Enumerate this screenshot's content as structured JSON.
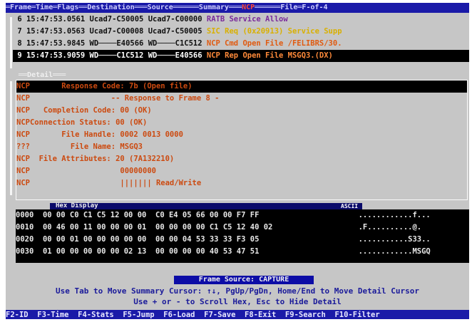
{
  "title_bar": {
    "left": "═Frame═Time═Flags══Destination═══Source══════Summary═══",
    "protocol": "NCP",
    "right": "══════File═F-of-4"
  },
  "summary_rows": [
    {
      "frame": " 6",
      "time": "15:47:53.0561",
      "dest": "Ucad7-C50005",
      "src": "Ucad7-C00000",
      "summary": "RATB Service Allow",
      "color": "purple"
    },
    {
      "frame": " 7",
      "time": "15:47:53.0563",
      "dest": "Ucad7-C00008",
      "src": "Ucad7-C50005",
      "summary": "SIC Req (0x20913) Service Supp",
      "color": "yellow"
    },
    {
      "frame": " 8",
      "time": "15:47:53.9845",
      "dest": "WD────E40566",
      "src": "WD────C1C512",
      "summary": "NCP Cmd Open File /FELIBRS/30.",
      "color": "orange"
    },
    {
      "frame": " 9",
      "time": "15:47:53.9059",
      "dest": "WD────C1C512",
      "src": "WD────E40566",
      "summary": "NCP Rep Open File MSGQ3.(DX)",
      "color": "ltorange",
      "selected": true
    }
  ],
  "detail_label": "══Detail═══",
  "detail_rows": [
    {
      "proto": "NCP",
      "text": "       Response Code: 7b (Open file)"
    },
    {
      "proto": "NCP",
      "text": "                  -- Response to Frame 8 -"
    },
    {
      "proto": "NCP",
      "text": "   Completion Code: 00 (OK)"
    },
    {
      "proto": "NCP",
      "text": "Connection Status: 00 (OK)"
    },
    {
      "proto": "NCP",
      "text": "       File Handle: 0002 0013 0000"
    },
    {
      "proto": "???",
      "text": "         File Name: MSGQ3"
    },
    {
      "proto": "NCP",
      "text": "  File Attributes: 20 (7A132210)"
    },
    {
      "proto": "NCP",
      "text": "                    00000000"
    },
    {
      "proto": "NCP",
      "text": "                    ||||||| Read/Write"
    }
  ],
  "hex_label": "Hex Display",
  "ascii_label": "ASCII",
  "hex_rows": [
    {
      "offset": "0000",
      "hex": "00 00 C0 C1 C5 12 00 00  C0 E4 05 66 00 00 F7 FF",
      "ascii": "............f..."
    },
    {
      "offset": "0010",
      "hex": "00 46 00 11 00 00 00 01  00 00 00 00 C1 C5 12 40 02",
      "ascii": ".F..........@."
    },
    {
      "offset": "0020",
      "hex": "00 00 01 00 00 00 00 00  00 00 04 53 33 33 F3 05",
      "ascii": "...........S33.."
    },
    {
      "offset": "0030",
      "hex": "01 00 00 00 00 00 02 13  00 00 00 00 40 53 47 51",
      "ascii": "............MSGQ"
    }
  ],
  "frame_source": "Frame Source: CAPTURE",
  "help_line1": "Use Tab to Move Summary Cursor: ↑↓, PgUp/PgDn, Home/End to Move Detail Cursor",
  "help_line2": "Use + or - to Scroll Hex, Esc to Hide Detail",
  "fkeys": "F2-ID  F3-Time  F4-Stats  F5-Jump  F6-Load  F7-Save  F8-Exit  F9-Search  F10-Filter"
}
